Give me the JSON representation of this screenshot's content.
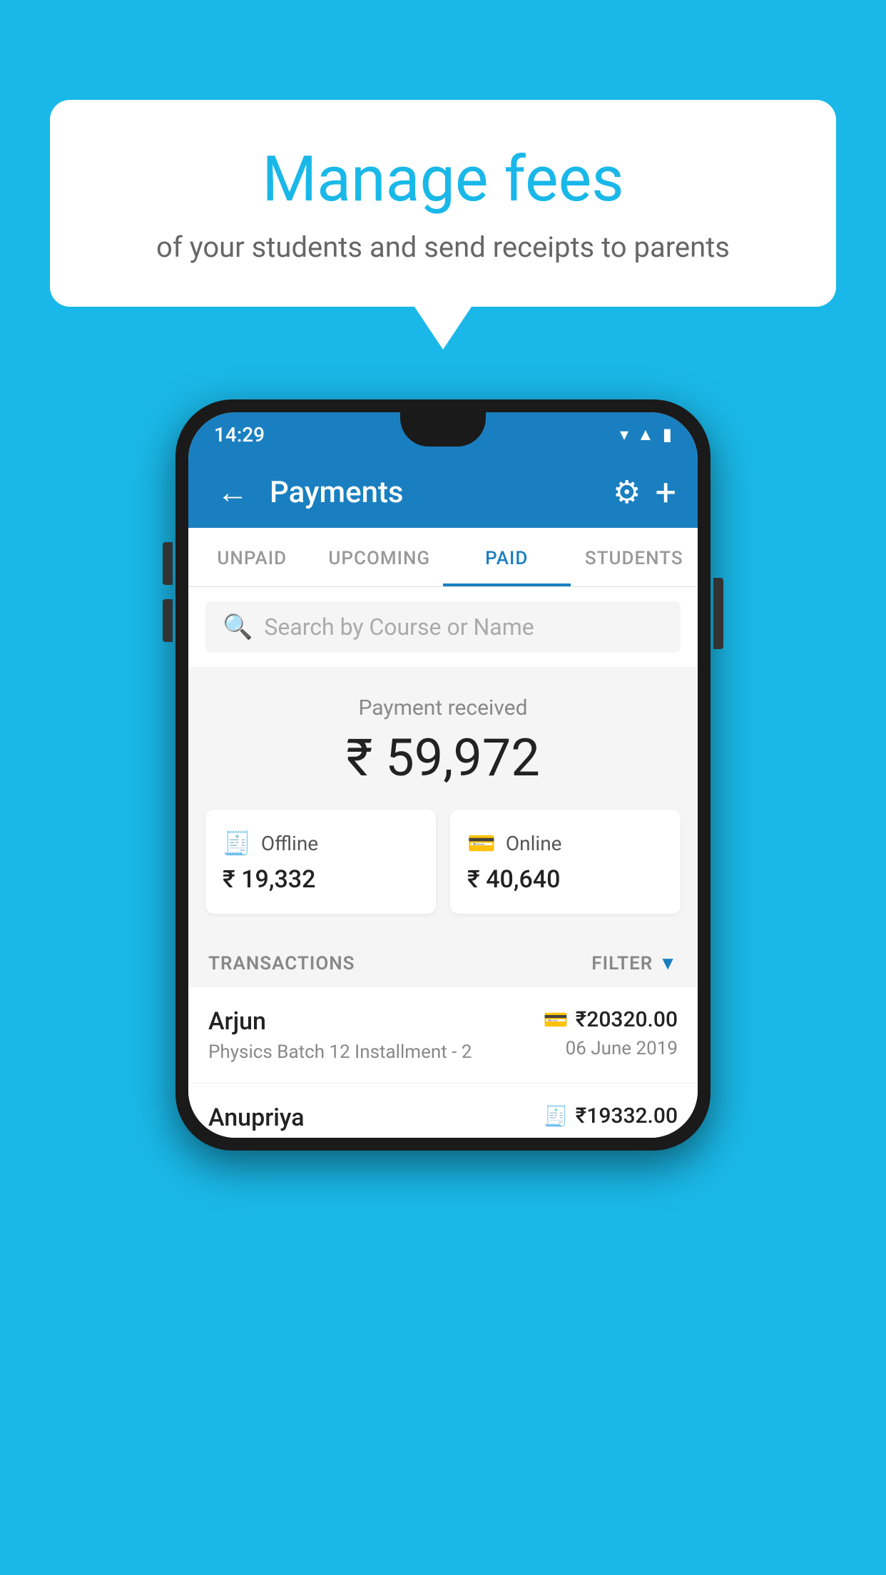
{
  "background_color": "#1ab8e8",
  "speech_bubble": {
    "title": "Manage fees",
    "subtitle": "of your students and send receipts to parents"
  },
  "status_bar": {
    "time": "14:29",
    "icons": [
      "wifi",
      "signal",
      "battery"
    ]
  },
  "app_bar": {
    "title": "Payments",
    "back_label": "←",
    "gear_label": "⚙",
    "plus_label": "+"
  },
  "tabs": [
    {
      "label": "UNPAID",
      "active": false
    },
    {
      "label": "UPCOMING",
      "active": false
    },
    {
      "label": "PAID",
      "active": true
    },
    {
      "label": "STUDENTS",
      "active": false
    }
  ],
  "search": {
    "placeholder": "Search by Course or Name"
  },
  "payment_summary": {
    "label": "Payment received",
    "amount": "₹ 59,972"
  },
  "payment_cards": [
    {
      "type": "Offline",
      "amount": "₹ 19,332",
      "icon": "offline"
    },
    {
      "type": "Online",
      "amount": "₹ 40,640",
      "icon": "online"
    }
  ],
  "transactions": {
    "label": "TRANSACTIONS",
    "filter_label": "FILTER",
    "rows": [
      {
        "name": "Arjun",
        "description": "Physics Batch 12 Installment - 2",
        "amount": "₹20320.00",
        "date": "06 June 2019",
        "payment_type": "online"
      },
      {
        "name": "Anupriya",
        "description": "",
        "amount": "₹19332.00",
        "date": "",
        "payment_type": "offline"
      }
    ]
  }
}
